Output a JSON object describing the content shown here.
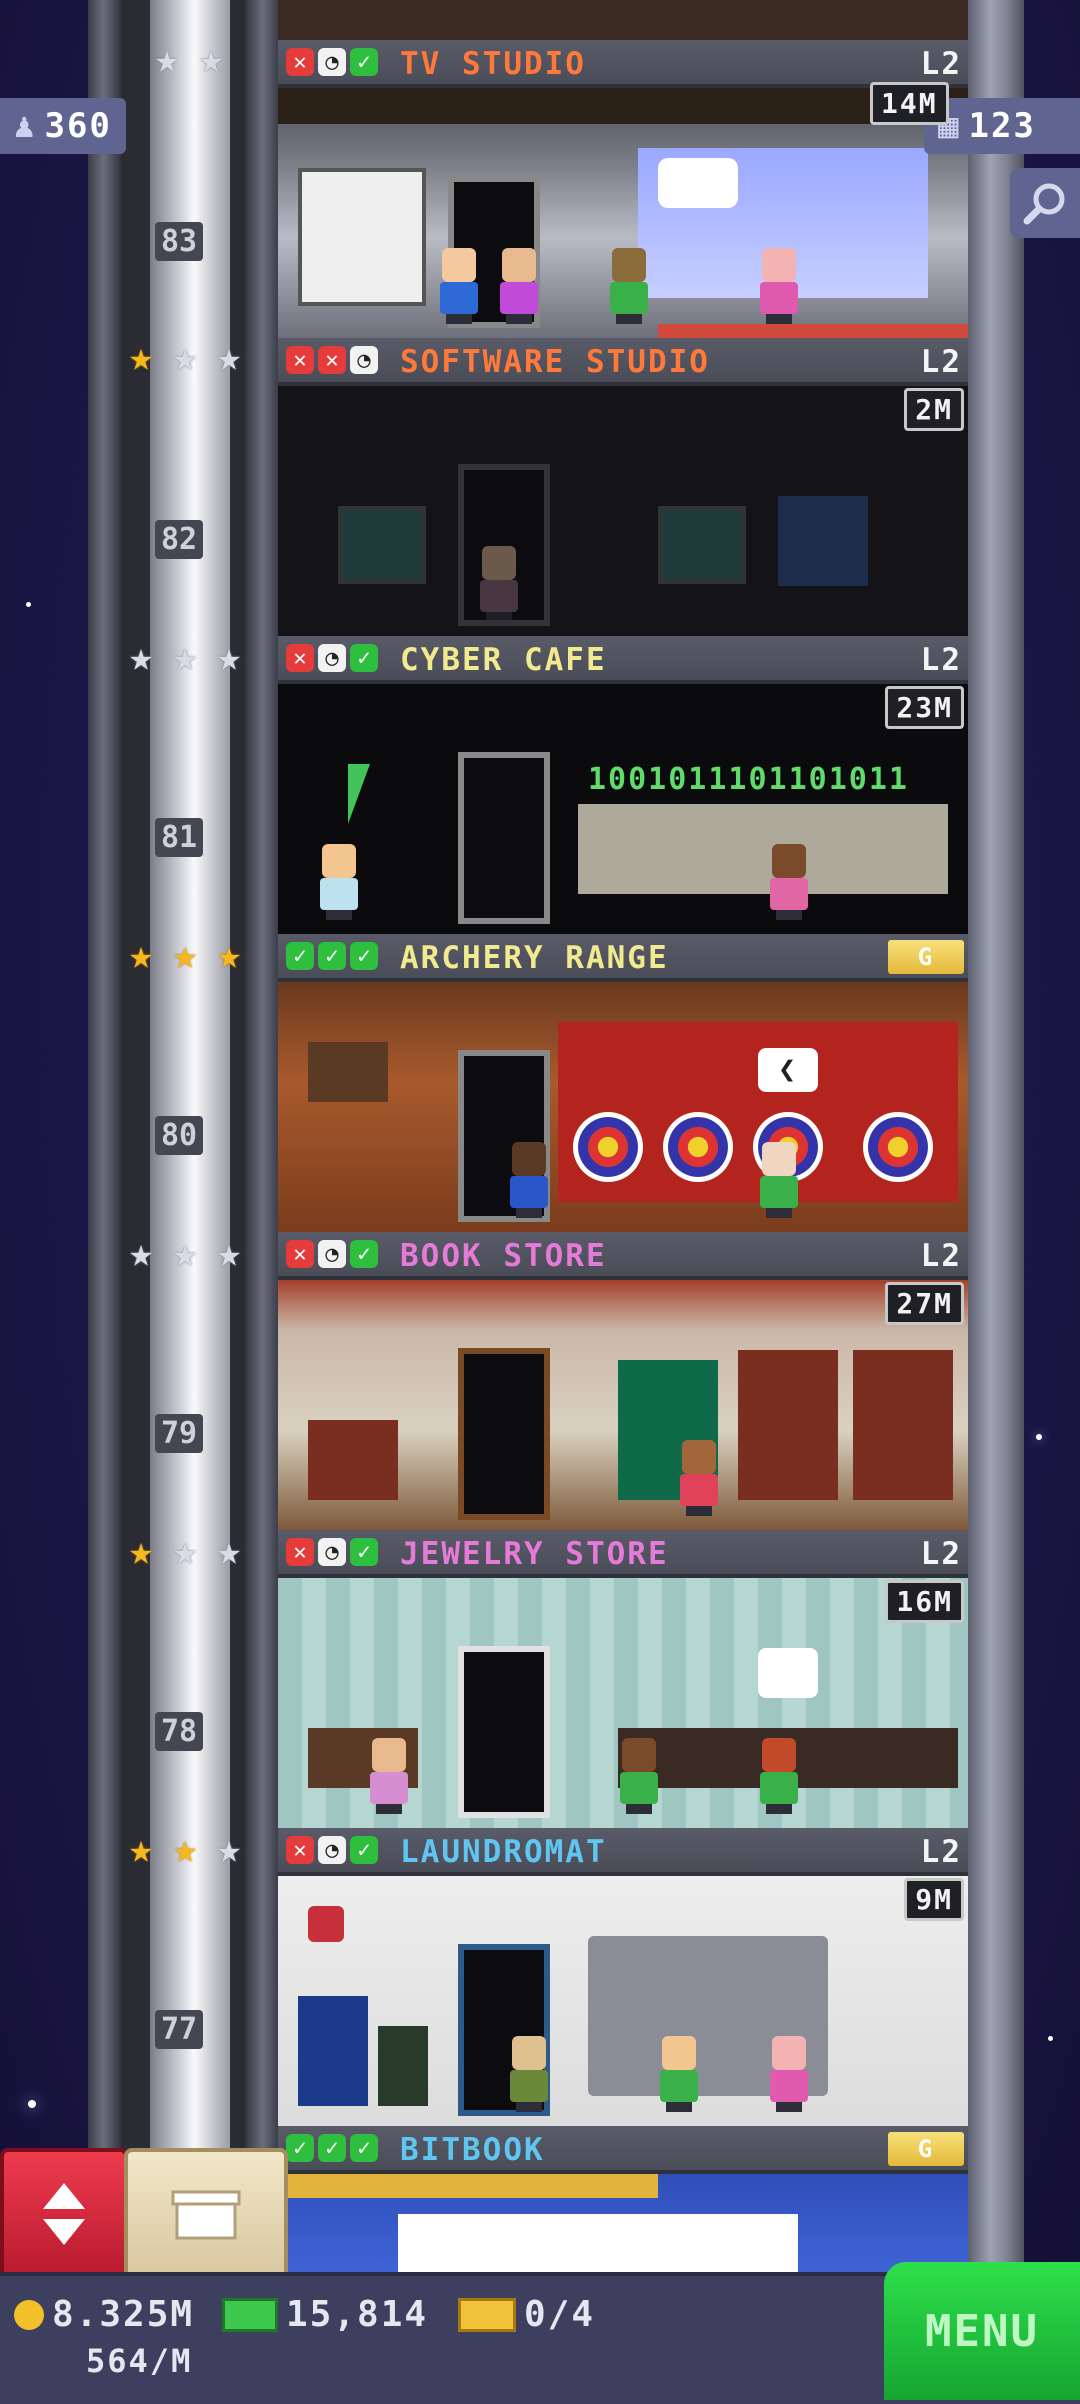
{
  "hud": {
    "population": "360",
    "bux_count": "123",
    "coins": "8.325M",
    "coins_rate": "564/M",
    "bux": "15,814",
    "tickets": "0/4",
    "menu_label": "MENU"
  },
  "floors": [
    {
      "name": "TV STUDIO",
      "name_color": "#ff7a3a",
      "level": "L2",
      "revenue": "14M",
      "number": "83",
      "stars": [
        "silver",
        "silver",
        "none"
      ],
      "status": [
        "x",
        "c",
        "k"
      ]
    },
    {
      "name": "SOFTWARE STUDIO",
      "name_color": "#ff7a3a",
      "level": "L2",
      "revenue": "2M",
      "number": "82",
      "stars": [
        "gold",
        "silver",
        "silver"
      ],
      "status": [
        "x",
        "x",
        "c"
      ]
    },
    {
      "name": "CYBER CAFE",
      "name_color": "#f1ea8e",
      "level": "L2",
      "revenue": "23M",
      "number": "81",
      "stars": [
        "silver",
        "silver",
        "silver"
      ],
      "status": [
        "x",
        "c",
        "k"
      ]
    },
    {
      "name": "ARCHERY RANGE",
      "name_color": "#f1ea8e",
      "level": "G",
      "revenue": "",
      "number": "80",
      "stars": [
        "gold",
        "gold",
        "gold"
      ],
      "status": [
        "k",
        "k",
        "k"
      ]
    },
    {
      "name": "BOOK STORE",
      "name_color": "#e57ad8",
      "level": "L2",
      "revenue": "27M",
      "number": "79",
      "stars": [
        "silver",
        "silver",
        "silver"
      ],
      "status": [
        "x",
        "c",
        "k"
      ]
    },
    {
      "name": "JEWELRY STORE",
      "name_color": "#e57ad8",
      "level": "L2",
      "revenue": "16M",
      "number": "78",
      "stars": [
        "gold",
        "silver",
        "silver"
      ],
      "status": [
        "x",
        "c",
        "k"
      ]
    },
    {
      "name": "LAUNDROMAT",
      "name_color": "#5fc6f2",
      "level": "L2",
      "revenue": "9M",
      "number": "77",
      "stars": [
        "gold",
        "gold",
        "silver"
      ],
      "status": [
        "x",
        "c",
        "k"
      ]
    },
    {
      "name": "BITBOOK",
      "name_color": "#5fc6f2",
      "level": "G",
      "revenue": "",
      "number": "",
      "stars": [
        "gold",
        "silver",
        "silver"
      ],
      "status": [
        "k",
        "k",
        "k"
      ]
    }
  ],
  "room_text": {
    "binary_sign": "1001011101101011",
    "archery_bubble": "❮"
  }
}
